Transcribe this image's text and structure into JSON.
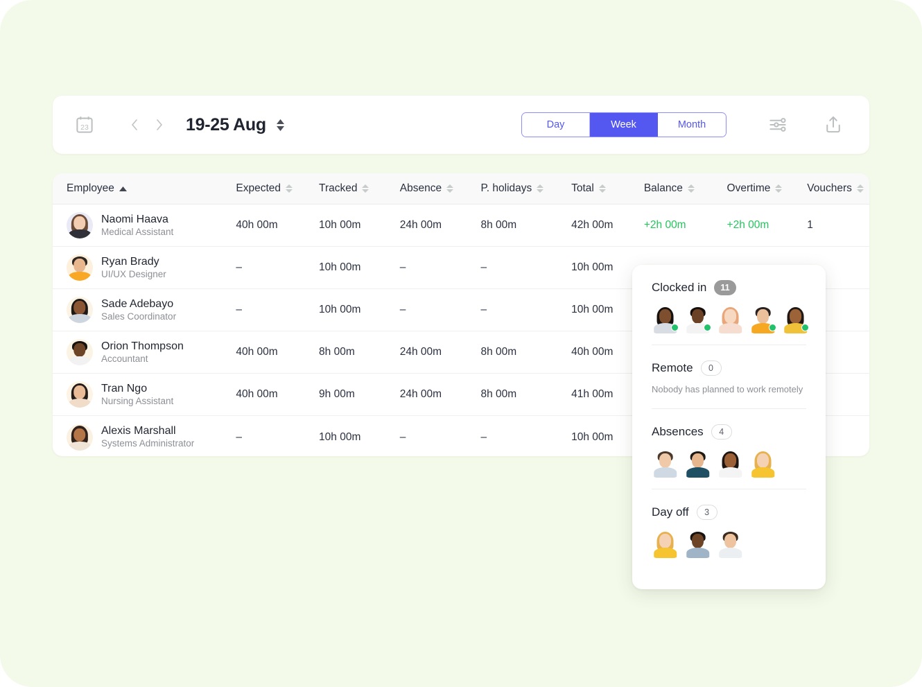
{
  "toolbar": {
    "calendar_icon": "calendar-23-icon",
    "prev_label": "previous-week",
    "next_label": "next-week",
    "date_range": "19-25 Aug",
    "stepper_icon": "sort-updown-icon",
    "view_options": [
      {
        "label": "Day",
        "active": false
      },
      {
        "label": "Week",
        "active": true
      },
      {
        "label": "Month",
        "active": false
      }
    ],
    "filter_icon": "sliders-filter-icon",
    "export_icon": "share-upload-icon",
    "accent_color": "#5457f0"
  },
  "table": {
    "columns": [
      {
        "key": "employee",
        "label": "Employee",
        "sorted": "asc"
      },
      {
        "key": "expected",
        "label": "Expected",
        "sorted": "none"
      },
      {
        "key": "tracked",
        "label": "Tracked",
        "sorted": "none"
      },
      {
        "key": "absence",
        "label": "Absence",
        "sorted": "none"
      },
      {
        "key": "pholidays",
        "label": "P.  holidays",
        "sorted": "none"
      },
      {
        "key": "total",
        "label": "Total",
        "sorted": "none"
      },
      {
        "key": "balance",
        "label": "Balance",
        "sorted": "none"
      },
      {
        "key": "overtime",
        "label": "Overtime",
        "sorted": "none"
      },
      {
        "key": "vouchers",
        "label": "Vouchers",
        "sorted": "none"
      }
    ],
    "positive_color": "#25c55e",
    "rows": [
      {
        "name": "Naomi Haava",
        "role": "Medical Assistant",
        "expected": "40h 00m",
        "tracked": "10h 00m",
        "absence": "24h 00m",
        "pholidays": "8h 00m",
        "total": "42h 00m",
        "balance": "+2h 00m",
        "overtime": "+2h 00m",
        "vouchers": "1"
      },
      {
        "name": "Ryan Brady",
        "role": "UI/UX Designer",
        "expected": "–",
        "tracked": "10h 00m",
        "absence": "–",
        "pholidays": "–",
        "total": "10h 00m",
        "balance": "",
        "overtime": "",
        "vouchers": ""
      },
      {
        "name": "Sade Adebayo",
        "role": "Sales Coordinator",
        "expected": "–",
        "tracked": "10h 00m",
        "absence": "–",
        "pholidays": "–",
        "total": "10h 00m",
        "balance": "",
        "overtime": "",
        "vouchers": ""
      },
      {
        "name": "Orion Thompson",
        "role": "Accountant",
        "expected": "40h 00m",
        "tracked": "8h 00m",
        "absence": "24h 00m",
        "pholidays": "8h 00m",
        "total": "40h 00m",
        "balance": "",
        "overtime": "",
        "vouchers": ""
      },
      {
        "name": "Tran Ngo",
        "role": "Nursing Assistant",
        "expected": "40h 00m",
        "tracked": "9h 00m",
        "absence": "24h 00m",
        "pholidays": "8h 00m",
        "total": "41h 00m",
        "balance": "",
        "overtime": "",
        "vouchers": ""
      },
      {
        "name": "Alexis Marshall",
        "role": "Systems Administrator",
        "expected": "–",
        "tracked": "10h 00m",
        "absence": "–",
        "pholidays": "–",
        "total": "10h 00m",
        "balance": "",
        "overtime": "",
        "vouchers": ""
      }
    ]
  },
  "status_panel": {
    "sections": [
      {
        "title": "Clocked in",
        "count": "11",
        "badge_style": "solid",
        "note": "",
        "avatar_count": 5
      },
      {
        "title": "Remote",
        "count": "0",
        "badge_style": "outline",
        "note": "Nobody has planned to work remotely",
        "avatar_count": 0
      },
      {
        "title": "Absences",
        "count": "4",
        "badge_style": "outline",
        "note": "",
        "avatar_count": 4
      },
      {
        "title": "Day off",
        "count": "3",
        "badge_style": "outline",
        "note": "",
        "avatar_count": 3
      }
    ],
    "online_dot_color": "#23c16b"
  }
}
